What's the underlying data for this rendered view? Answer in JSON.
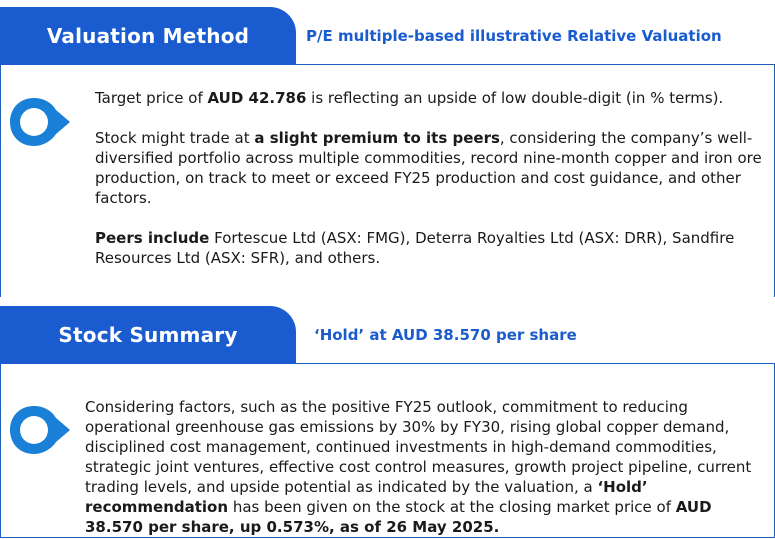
{
  "valuation": {
    "tab_label": "Valuation Method",
    "subtitle": "P/E multiple-based illustrative Relative Valuation",
    "para1": {
      "pre": "Target price of ",
      "bold": "AUD 42.786",
      "post": " is reflecting an upside of low double-digit (in % terms)."
    },
    "para2": {
      "pre": "Stock might trade at ",
      "bold": "a slight premium to its peers",
      "post": ", considering the company’s well-diversified portfolio across multiple commodities, record nine-month copper and iron ore production, on track to meet or exceed FY25 production and cost guidance, and other factors."
    },
    "para3": {
      "bold": "Peers include",
      "post": " Fortescue Ltd (ASX: FMG), Deterra Royalties Ltd (ASX: DRR), Sandfire Resources Ltd (ASX: SFR), and others."
    }
  },
  "summary": {
    "tab_label": "Stock Summary",
    "subtitle": "‘Hold’ at AUD 38.570 per share",
    "para": {
      "pre": "Considering factors, such as the positive FY25 outlook, commitment to reducing operational greenhouse gas emissions by 30% by FY30, rising global copper demand, disciplined cost management, continued investments in high-demand commodities, strategic joint ventures, effective cost control measures, growth project pipeline, current trading levels, and upside potential as indicated by the valuation, a ",
      "bold1": "‘Hold’ recommendation",
      "mid": " has been given on the stock at the closing market price of ",
      "bold2": "AUD 38.570 per share, up 0.573%, as of 26 May 2025."
    }
  },
  "colors": {
    "accent": "#1a5ccf",
    "pin_outer": "#1a7fd6",
    "pin_inner": "#ffffff"
  }
}
